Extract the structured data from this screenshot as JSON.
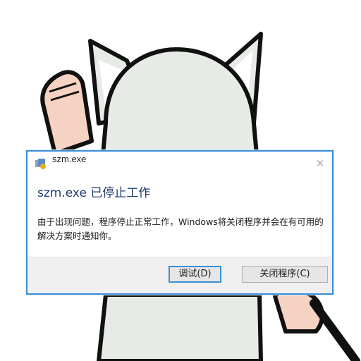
{
  "dialog": {
    "title": "szm.exe",
    "heading": "szm.exe 已停止工作",
    "message": "由于出现问题，程序停止正常工作，Windows将关闭程序并会在有可用的解决方案时通知你。",
    "debug_label": "调试(D)",
    "close_program_label": "关闭程序(C)",
    "close_glyph": "✕",
    "app_icon": "program-error-icon"
  },
  "background": {
    "illustration": "cartoon-cat-character",
    "colors": {
      "outline": "#111111",
      "body": "#e7ebe6",
      "arm": "#f6d2c2",
      "ear_inner": "#ffffff"
    }
  },
  "colors": {
    "accent": "#3a8fd6",
    "heading": "#1e3b6e",
    "footer": "#f0f0f0"
  }
}
